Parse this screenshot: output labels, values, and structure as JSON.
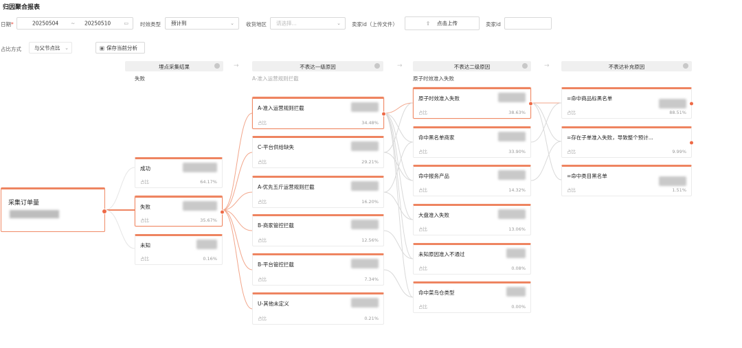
{
  "page_title": "归因聚合报表",
  "filters": {
    "date_label": "日期",
    "required_mark": "*",
    "date_start": "20250504",
    "date_sep": "~",
    "date_end": "20250510",
    "timing_type_label": "时效类型",
    "timing_type_value": "预计到",
    "region_label": "收货地区",
    "region_placeholder": "请选择...",
    "seller_upload_label": "卖家id（上传文件）",
    "upload_button": "点击上传",
    "seller_id_label": "卖家id",
    "seller_id_value": ""
  },
  "controls": {
    "ratio_method_label": "占比方式",
    "ratio_method_value": "与父节点比",
    "save_button": "保存当前分析"
  },
  "columns": [
    {
      "title": "埋点采集结果",
      "subtitle": "失败"
    },
    {
      "title": "不表达一级原因",
      "subtitle": "A-准入运营规则拦截"
    },
    {
      "title": "不表达二级原因",
      "subtitle": "原子时效准入失败"
    },
    {
      "title": "不表达补充原因",
      "subtitle": ""
    }
  ],
  "root": {
    "label": "采集订单量"
  },
  "ratio_label": "占比",
  "col1_cards": [
    {
      "label": "成功",
      "pct": "64.17%"
    },
    {
      "label": "失败",
      "pct": "35.67%"
    },
    {
      "label": "未知",
      "pct": "0.16%"
    }
  ],
  "col2_cards": [
    {
      "label": "A-准入运营规则拦截",
      "pct": "34.48%"
    },
    {
      "label": "C-平台供给缺失",
      "pct": "29.21%"
    },
    {
      "label": "A-优先五斤运营规则拦截",
      "pct": "16.20%"
    },
    {
      "label": "B-商家管控拦截",
      "pct": "12.56%"
    },
    {
      "label": "B-平台管控拦截",
      "pct": "7.34%"
    },
    {
      "label": "U-其他未定义",
      "pct": "0.21%"
    }
  ],
  "col3_cards": [
    {
      "label": "原子时效准入失败",
      "pct": "38.63%"
    },
    {
      "label": "命中黑名单商家",
      "pct": "33.90%"
    },
    {
      "label": "命中报务产品",
      "pct": "14.32%"
    },
    {
      "label": "大盘准入失败",
      "pct": "13.06%"
    },
    {
      "label": "未知原因准入不通过",
      "pct": "0.08%"
    },
    {
      "label": "命中菜鸟仓类型",
      "pct": "0.00%"
    }
  ],
  "col4_cards": [
    {
      "label": "=命中商品标黑名单",
      "pct": "88.51%"
    },
    {
      "label": "=存在子单准入失败，导致整个预计...",
      "pct": "9.99%"
    },
    {
      "label": "=命中类目黑名单",
      "pct": "1.51%"
    }
  ],
  "colors": {
    "accent": "#ee8460",
    "link": "#f2a58a",
    "link_muted": "#d9d9d9"
  },
  "icons": [
    "calendar-icon",
    "chevron-down-icon",
    "upload-icon",
    "save-icon",
    "settings-icon",
    "arrow-right-icon"
  ]
}
